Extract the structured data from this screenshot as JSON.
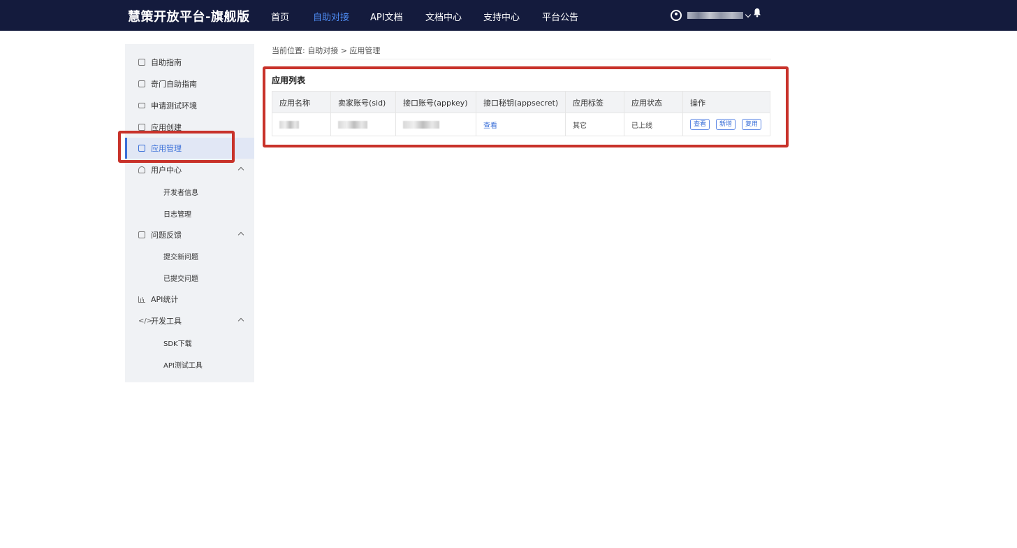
{
  "header": {
    "brand": "慧策开放平台-旗舰版",
    "nav": [
      {
        "label": "首页",
        "active": false
      },
      {
        "label": "自助对接",
        "active": true
      },
      {
        "label": "API文档",
        "active": false
      },
      {
        "label": "文档中心",
        "active": false
      },
      {
        "label": "支持中心",
        "active": false
      },
      {
        "label": "平台公告",
        "active": false
      }
    ]
  },
  "sidebar": {
    "items": [
      {
        "label": "自助指南"
      },
      {
        "label": "奇门自助指南"
      },
      {
        "label": "申请测试环境"
      },
      {
        "label": "应用创建"
      },
      {
        "label": "应用管理",
        "active": true
      },
      {
        "label": "用户中心"
      },
      {
        "label": "开发者信息"
      },
      {
        "label": "日志管理"
      },
      {
        "label": "问题反馈"
      },
      {
        "label": "提交新问题"
      },
      {
        "label": "已提交问题"
      },
      {
        "label": "API统计"
      },
      {
        "label": "开发工具"
      },
      {
        "label": "SDK下载"
      },
      {
        "label": "API测试工具"
      }
    ]
  },
  "breadcrumb": "当前位置:  自助对接 > 应用管理",
  "panel": {
    "title": "应用列表",
    "columns": [
      "应用名称",
      "卖家账号(sid)",
      "接口账号(appkey)",
      "接口秘钥(appsecret)",
      "应用标签",
      "应用状态",
      "操作"
    ],
    "row": {
      "secret_link": "查看",
      "tag": "其它",
      "status": "已上线",
      "actions": [
        "查看",
        "新增",
        "复用"
      ]
    }
  },
  "colors": {
    "header_bg": "#141b3d",
    "accent": "#3a6fd8",
    "highlight": "#c8322a"
  }
}
